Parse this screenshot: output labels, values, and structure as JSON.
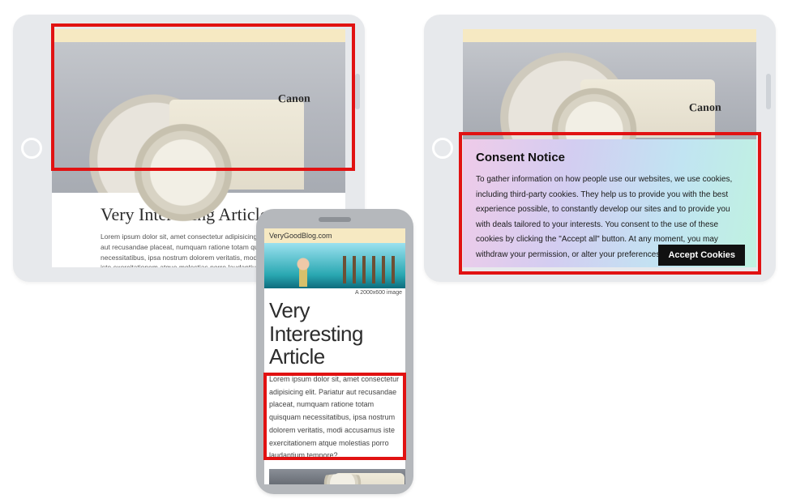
{
  "left_tablet": {
    "article_title": "Very Interesting Article",
    "article_body": "Lorem ipsum dolor sit, amet consectetur adipisicing elit. Pariatur aut recusandae placeat, numquam ratione totam quisquam necessitatibus, ipsa nostrum dolorem veritatis, modi accusamus iste exercitationem atque molestias porro laudantium tempore?",
    "hero_brand": "Canon"
  },
  "right_tablet": {
    "consent_title": "Consent Notice",
    "consent_body": "To gather information on how people use our websites, we use cookies, including third-party cookies. They help us to provide you with the best experience possible, to constantly develop our sites and to provide you with deals tailored to your interests. You consent to the use of these cookies by clicking the \"Accept all\" button. At any moment, you may withdraw your permission, or alter your preferences.",
    "accept_button": "Accept Cookies",
    "hero_brand": "Canon"
  },
  "phone": {
    "site_name": "VeryGoodBlog.com",
    "image_caption": "A 2000x600 image",
    "article_title": "Very Interesting Article",
    "article_body": "Lorem ipsum dolor sit, amet consectetur adipisicing elit. Pariatur aut recusandae placeat, numquam ratione totam quisquam necessitatibus, ipsa nostrum dolorem veritatis, modi accusamus iste exercitationem atque molestias porro laudantium tempore?"
  }
}
